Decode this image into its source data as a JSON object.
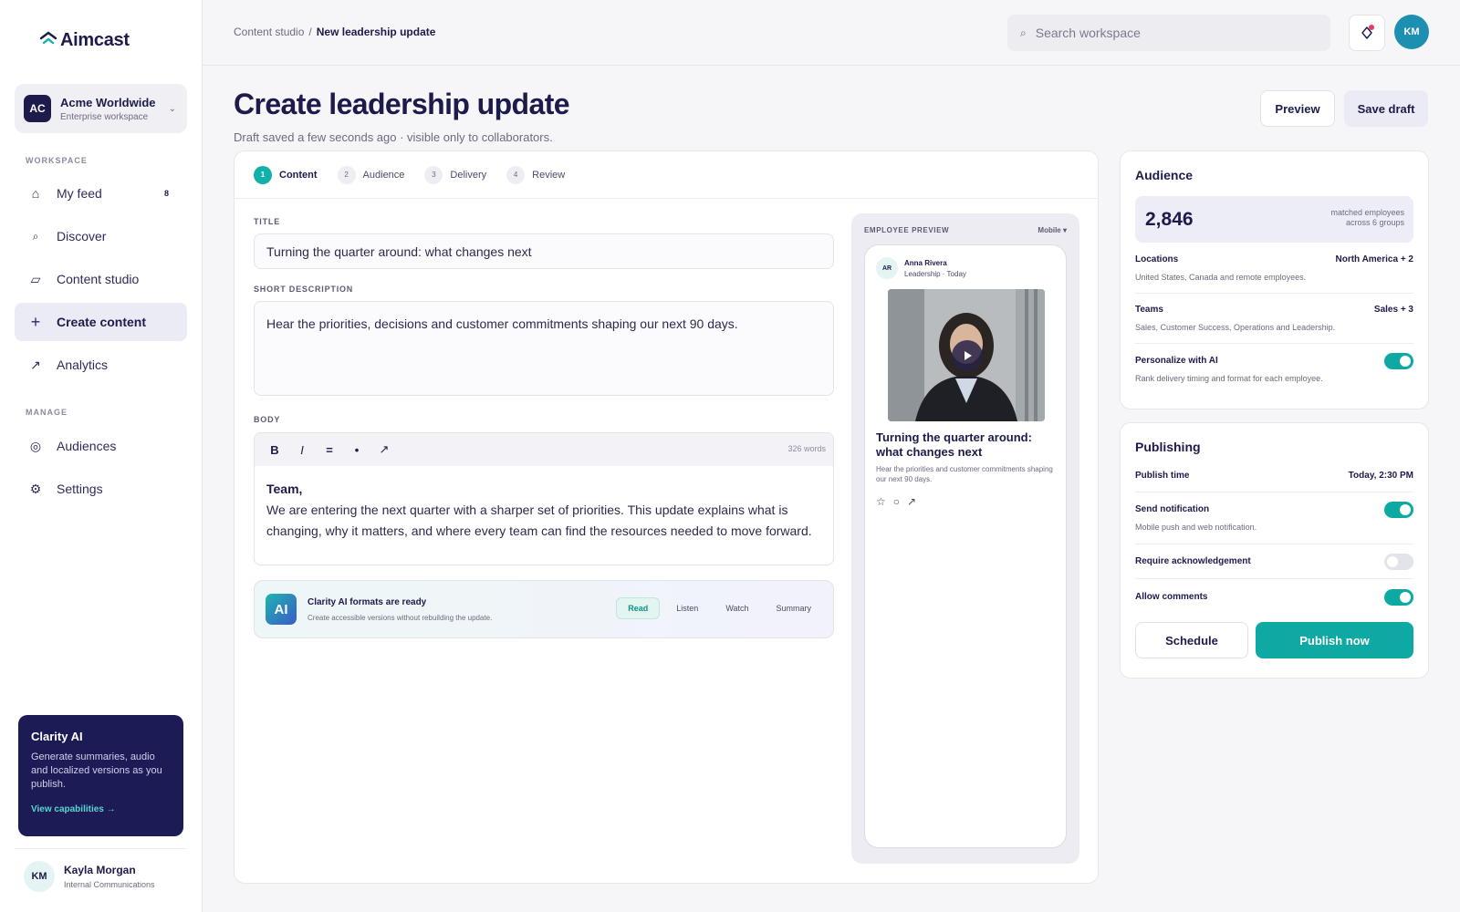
{
  "brand": {
    "name": "Aimcast",
    "accent": "#0fa9a3",
    "navy": "#1d1b4b"
  },
  "workspace": {
    "initials": "AC",
    "name": "Acme Worldwide",
    "sub": "Enterprise workspace"
  },
  "sidebar": {
    "section_workspace": "WORKSPACE",
    "section_manage": "MANAGE",
    "items": [
      {
        "label": "My feed",
        "icon": "home-icon",
        "badge": "8"
      },
      {
        "label": "Discover",
        "icon": "search-icon"
      },
      {
        "label": "Content studio",
        "icon": "folder-icon"
      },
      {
        "label": "Create content",
        "icon": "plus-icon",
        "active": true
      },
      {
        "label": "Analytics",
        "icon": "trend-icon"
      },
      {
        "label": "Audiences",
        "icon": "target-icon"
      },
      {
        "label": "Settings",
        "icon": "gear-icon"
      }
    ],
    "clarity": {
      "title": "Clarity AI",
      "body": "Generate summaries, audio and localized versions as you publish.",
      "link": "View capabilities →"
    },
    "user": {
      "initials": "KM",
      "name": "Kayla Morgan",
      "role": "Internal Communications"
    }
  },
  "topbar": {
    "breadcrumb_root": "Content studio",
    "breadcrumb_sep": "/",
    "breadcrumb_current": "New leadership update",
    "search_placeholder": "Search workspace",
    "avatar_initials": "KM"
  },
  "header": {
    "title": "Create leadership update",
    "subtitle": "Draft saved a few seconds ago · visible only to collaborators.",
    "preview_label": "Preview",
    "save_label": "Save draft"
  },
  "steps": [
    {
      "num": "1",
      "label": "Content",
      "active": true
    },
    {
      "num": "2",
      "label": "Audience"
    },
    {
      "num": "3",
      "label": "Delivery"
    },
    {
      "num": "4",
      "label": "Review"
    }
  ],
  "form": {
    "title_label": "TITLE",
    "title_value": "Turning the quarter around: what changes next",
    "desc_label": "SHORT DESCRIPTION",
    "desc_value": "Hear the priorities, decisions and customer commitments shaping our next 90 days.",
    "body_label": "BODY",
    "toolbar": [
      "B",
      "I",
      "=",
      "•",
      "↗"
    ],
    "word_count": "326 words",
    "body_greeting": "Team,",
    "body_text": "We are entering the next quarter with a sharper set of priorities. This update explains what is changing, why it matters, and where every team can find the resources needed to move forward."
  },
  "ai_banner": {
    "badge": "AI",
    "title": "Clarity AI formats are ready",
    "sub": "Create accessible versions without rebuilding the update.",
    "tabs": [
      "Read",
      "Listen",
      "Watch",
      "Summary"
    ],
    "active_tab": "Read"
  },
  "preview": {
    "label": "EMPLOYEE PREVIEW",
    "mode": "Mobile ▾",
    "author_initials": "AR",
    "author": "Anna Rivera",
    "meta": "Leadership · Today",
    "post_title": "Turning the quarter around: what changes next",
    "post_desc": "Hear the priorities and customer commitments shaping our next 90 days."
  },
  "audience": {
    "title": "Audience",
    "matched_count": "2,846",
    "matched_label_1": "matched employees",
    "matched_label_2": "across 6 groups",
    "locations_label": "Locations",
    "locations_value": "North America + 2",
    "locations_sub": "United States, Canada and remote employees.",
    "teams_label": "Teams",
    "teams_value": "Sales + 3",
    "teams_sub": "Sales, Customer Success, Operations and Leadership.",
    "personalize_label": "Personalize with AI",
    "personalize_sub": "Rank delivery timing and format for each employee.",
    "personalize_on": true
  },
  "publishing": {
    "title": "Publishing",
    "time_label": "Publish time",
    "time_value": "Today, 2:30 PM",
    "notify_label": "Send notification",
    "notify_sub": "Mobile push and web notification.",
    "notify_on": true,
    "ack_label": "Require acknowledgement",
    "ack_on": false,
    "comments_label": "Allow comments",
    "comments_on": true,
    "schedule_label": "Schedule",
    "publish_label": "Publish now"
  }
}
